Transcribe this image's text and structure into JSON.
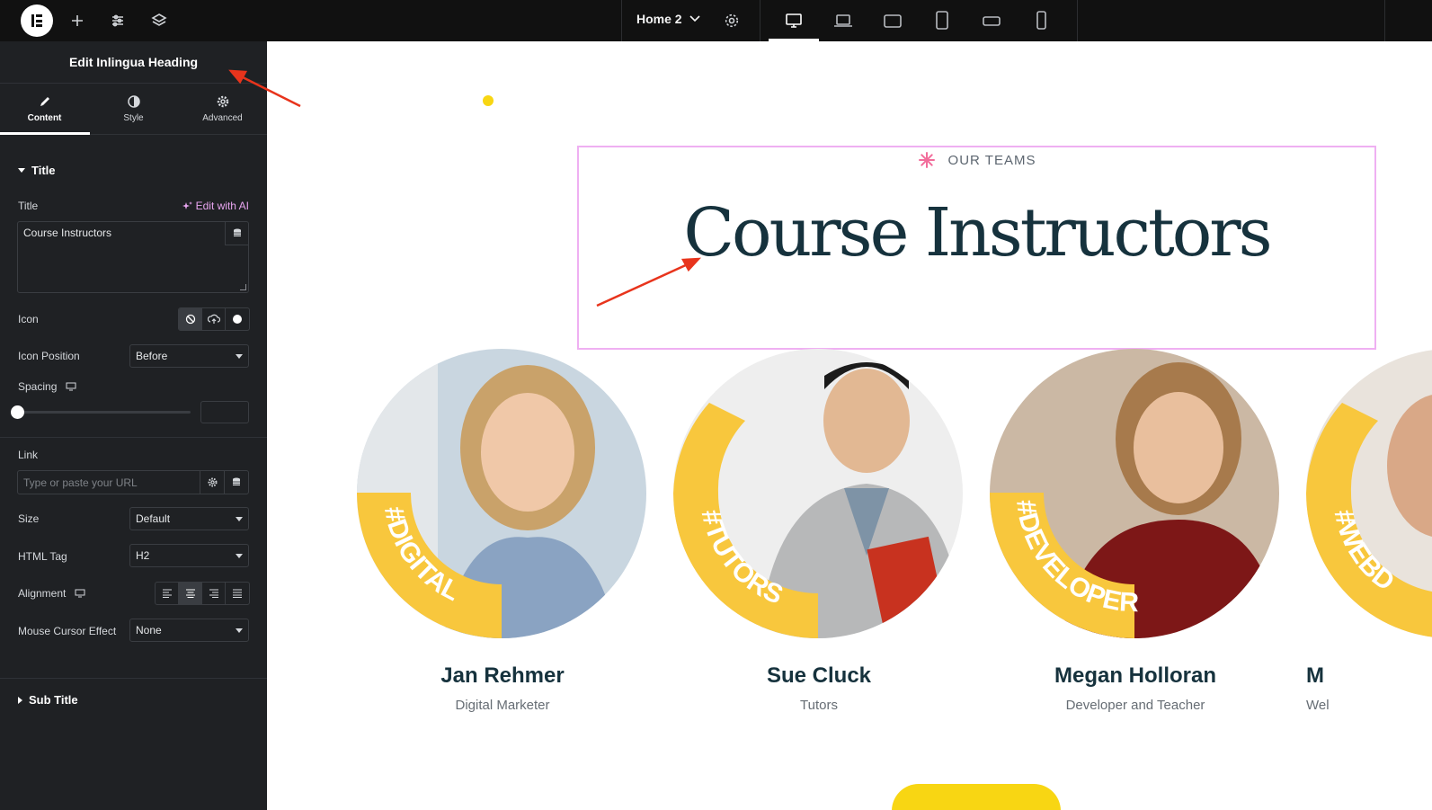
{
  "topbar": {
    "page_name": "Home 2"
  },
  "panel": {
    "title": "Edit Inlingua Heading",
    "tabs": [
      {
        "label": "Content"
      },
      {
        "label": "Style"
      },
      {
        "label": "Advanced"
      }
    ],
    "sections": {
      "title_section": "Title",
      "sub_title_section": "Sub Title"
    },
    "fields": {
      "title_label": "Title",
      "edit_ai": "Edit with AI",
      "title_value": "Course Instructors",
      "icon_label": "Icon",
      "icon_position_label": "Icon Position",
      "icon_position_value": "Before",
      "spacing_label": "Spacing",
      "link_label": "Link",
      "link_placeholder": "Type or paste your URL",
      "size_label": "Size",
      "size_value": "Default",
      "html_tag_label": "HTML Tag",
      "html_tag_value": "H2",
      "alignment_label": "Alignment",
      "mouse_cursor_label": "Mouse Cursor Effect",
      "mouse_cursor_value": "None"
    }
  },
  "canvas": {
    "section_subtitle": "OUR TEAMS",
    "section_heading": "Course Instructors",
    "accent": "#f8d613",
    "instructors": [
      {
        "name": "Jan Rehmer",
        "role": "Digital Marketer",
        "tag": "#DIGITAL"
      },
      {
        "name": "Sue Cluck",
        "role": "Tutors",
        "tag": "#TUTORS"
      },
      {
        "name": "Megan Holloran",
        "role": "Developer and Teacher",
        "tag": "#DEVELOPER"
      },
      {
        "name": "M",
        "role": "Wel",
        "tag": "#WEBD"
      }
    ]
  }
}
